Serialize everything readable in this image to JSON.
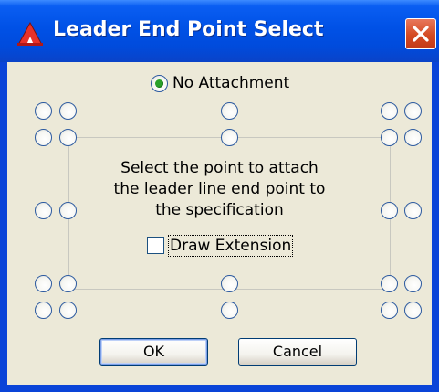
{
  "window": {
    "title": "Leader End Point Select",
    "icon": "app-logo-icon",
    "close_icon": "close-icon"
  },
  "dialog": {
    "no_attachment_label": "No Attachment",
    "no_attachment_selected": true,
    "instruction_line1": "Select the point to attach",
    "instruction_line2": "the leader line end point to",
    "instruction_line3": "the specification",
    "draw_extension_label": "Draw Extension",
    "draw_extension_checked": false,
    "ok_label": "OK",
    "cancel_label": "Cancel"
  },
  "colors": {
    "titlebar": "#0051e6",
    "dialog_background": "#ece9d8",
    "close_button": "#d44a22",
    "selected_radio": "#2aa12a"
  }
}
